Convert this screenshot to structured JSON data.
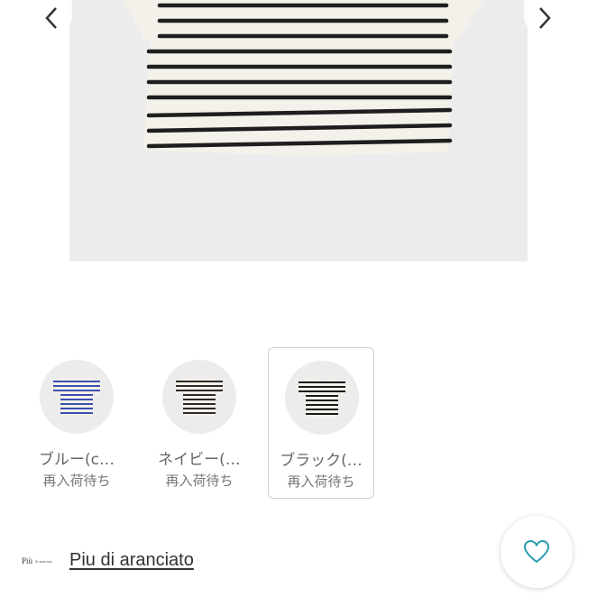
{
  "carousel": {
    "prev_icon": "chevron-left-icon",
    "next_icon": "chevron-right-icon"
  },
  "main_image": {
    "subject": "striped-tshirt",
    "stripe_color": "#1e1e1e",
    "base_color": "#f4f1ea"
  },
  "variants": [
    {
      "name": "ブルー(c…",
      "status": "再入荷待ち",
      "stripe_color": "#3b4fb0",
      "selected": false
    },
    {
      "name": "ネイビー(…",
      "status": "再入荷待ち",
      "stripe_color": "#2f2a28",
      "selected": false
    },
    {
      "name": "ブラック(…",
      "status": "再入荷待ち",
      "stripe_color": "#1a1a1a",
      "selected": true
    }
  ],
  "brand": {
    "logo_text_main": "Più",
    "logo_text_sub": "di aranciato",
    "name": "Piu di aranciato"
  },
  "favorite": {
    "icon": "heart-icon",
    "color": "#2a9bb0"
  }
}
